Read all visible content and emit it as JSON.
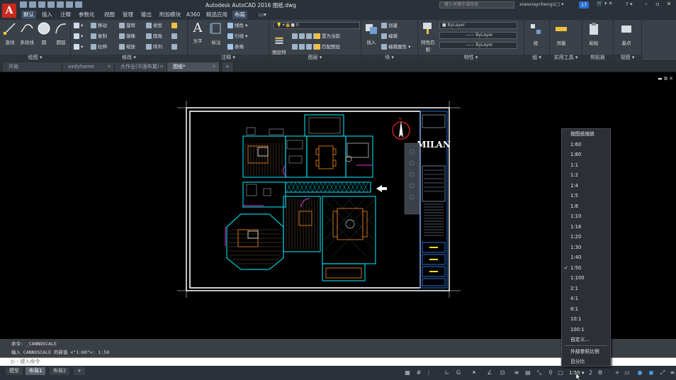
{
  "titlebar": {
    "title": "Autodesk AutoCAD 2016    图纸.dwg",
    "search_placeholder": "键入关键字或短语",
    "username": "xiaoxiaycheng1□ ▾",
    "notification_count": "17"
  },
  "menu_tabs": [
    "默认",
    "插入",
    "注释",
    "参数化",
    "视图",
    "管理",
    "输出",
    "附加模块",
    "A360",
    "精选应用",
    "布局",
    "▭▾"
  ],
  "active_menu_tab": "布局",
  "ribbon": {
    "draw_panel": {
      "title": "绘图 ▾",
      "tools": [
        "直线",
        "多段线",
        "圆",
        "圆弧"
      ]
    },
    "modify_panel": {
      "title": "修改 ▾",
      "tools": [
        "移动",
        "旋转",
        "修剪",
        "复制",
        "镜像",
        "圆角",
        "拉伸",
        "缩放",
        "阵列"
      ]
    },
    "annotation_panel": {
      "title": "注释 ▾",
      "tools": [
        "文字",
        "标注",
        "线性",
        "引线",
        "表格"
      ]
    },
    "layers_panel": {
      "title": "图层 ▾",
      "big_tool": "图层特性",
      "layer_value": "0",
      "tools": [
        "置为当前",
        "匹配图层"
      ]
    },
    "block_panel": {
      "title": "块 ▾",
      "big_tool": "插入",
      "tools": [
        "创建",
        "编辑",
        "编辑属性"
      ]
    },
    "properties_panel": {
      "title": "特性 ▾",
      "big_tool": "特性匹配",
      "color": "ByLayer",
      "linetype": "ByLayer",
      "lineweight": "ByLayer"
    },
    "groups_panel": {
      "title": "组 ▾",
      "big_tool": "组"
    },
    "utilities_panel": {
      "title": "实用工具 ▾",
      "big_tool": "测量"
    },
    "clipboard_panel": {
      "title": "剪贴板",
      "big_tool": "粘贴"
    },
    "view_panel": {
      "title": "视图 ▾",
      "big_tool": "基点"
    }
  },
  "doc_tabs": [
    {
      "label": "开始",
      "active": false
    },
    {
      "label": "xxdyhome",
      "active": false
    },
    {
      "label": "大作业(平面布置)",
      "active": false
    },
    {
      "label": "图纸*",
      "active": true
    }
  ],
  "viewport_controls": "▬  ⧉  ✕",
  "command": {
    "history_line1": "命令: _CANNOSCALE",
    "history_line2": "输入 CANNOSCALE 的新值 <\"1:60\">: 1:50",
    "input_placeholder": "键入命令"
  },
  "layout_tabs": [
    {
      "label": "模型",
      "active": false
    },
    {
      "label": "布局1",
      "active": true
    },
    {
      "label": "布局2",
      "active": false
    }
  ],
  "statusbar": {
    "annotation_scale": "1:50"
  },
  "scale_menu": {
    "items": [
      "按图纸缩放",
      "1:60",
      "1:80",
      "1:1",
      "1:2",
      "1:4",
      "1:5",
      "1:8",
      "1:10",
      "1:16",
      "1:20",
      "1:30",
      "1:40",
      "1:50",
      "1:100",
      "2:1",
      "4:1",
      "8:1",
      "10:1",
      "100:1",
      "自定义..."
    ],
    "checked": "1:50",
    "footer_items": [
      "外部参照比例",
      "百分比"
    ]
  },
  "title_block": {
    "logo_text": "MILAN"
  },
  "colors": {
    "accent": "#3a4e66",
    "ribbon_bg": "#3b4149",
    "wall_cyan": "#00c8d8",
    "furniture_orange": "#e07a1a",
    "door_magenta": "#e030d8",
    "compass_red": "#e02020"
  }
}
